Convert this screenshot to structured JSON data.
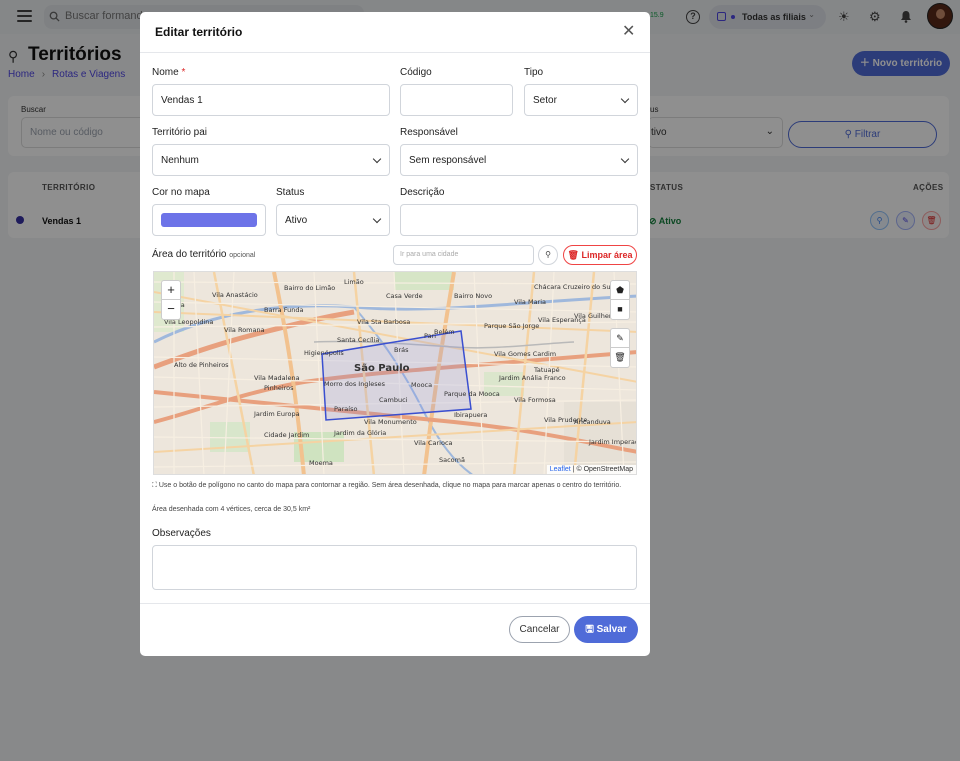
{
  "topbar": {
    "search_placeholder": "Buscar formando...",
    "version": "15.9",
    "help": "?",
    "branch_label": "Todas as filiais",
    "branch_chevron": "⌄"
  },
  "page": {
    "title": "Territórios",
    "breadcrumb": [
      "Home",
      "Rotas e Viagens"
    ],
    "new_button": "Novo território"
  },
  "filters": {
    "search_label": "Buscar",
    "search_placeholder": "Nome ou código",
    "status_label": "us",
    "status_value": "tivo",
    "filter_button": "Filtrar"
  },
  "table": {
    "columns": [
      "TERRITÓRIO",
      "STATUS",
      "AÇÕES"
    ],
    "rows": [
      {
        "name": "Vendas 1",
        "status": "Ativo"
      }
    ]
  },
  "modal": {
    "title": "Editar território",
    "fields": {
      "name": {
        "label": "Nome",
        "required": "*",
        "value": "Vendas 1"
      },
      "code": {
        "label": "Código",
        "value": ""
      },
      "type": {
        "label": "Tipo",
        "value": "Setor"
      },
      "parent": {
        "label": "Território pai",
        "value": "Nenhum"
      },
      "responsible": {
        "label": "Responsável",
        "value": "Sem responsável"
      },
      "color": {
        "label": "Cor no mapa",
        "value": "#6d73e8"
      },
      "status": {
        "label": "Status",
        "value": "Ativo"
      },
      "description": {
        "label": "Descrição",
        "value": ""
      }
    },
    "area": {
      "label": "Área do território",
      "optional": "opcional",
      "city_placeholder": "Ir para uma cidade",
      "clear_button": "Limpar área",
      "map": {
        "zoom_in": "+",
        "zoom_out": "−",
        "places": [
          "Vila Anastácio",
          "Bairro do Limão",
          "Limão",
          "Casa Verde",
          "Bairro Novo",
          "Chácara Cruzeiro do Sul",
          "Lapa",
          "Barra Funda",
          "Vila Maria",
          "Vila Leopoldina",
          "Vila Sta Barbosa",
          "Vila Esperança",
          "Vila Guilherme",
          "Vila Romana",
          "Santa Cecília",
          "Pari",
          "Parque São Jorge",
          "Higienópolis",
          "Belém",
          "Alto de Pinheiros",
          "Brás",
          "Vila Gomes Cardim",
          "São Paulo",
          "Vila Madalena",
          "Tatuapé",
          "Morro dos Ingleses",
          "Mooca",
          "Jardim Anália Franco",
          "Pinheiros",
          "Cambuci",
          "Parque da Mooca",
          "Vila Formosa",
          "Jardim Europa",
          "Paraíso",
          "Ibirapuera",
          "Vila Monumento",
          "Jardim da Glória",
          "Vila Prudente",
          "Cidade Jardim",
          "Vila Carioca",
          "Aricanduva",
          "Moema",
          "Sacomã",
          "Jardim Imperador"
        ],
        "attribution_leaflet": "Leaflet",
        "attribution_osm": "| © OpenStreetMap"
      },
      "hint": "Use o botão de polígono no canto do mapa para contornar a região. Sem área desenhada, clique no mapa para marcar apenas o centro do território.",
      "drawn_info": "Área desenhada com 4 vértices, cerca de 30,5 km²"
    },
    "observations": {
      "label": "Observações",
      "value": ""
    },
    "buttons": {
      "cancel": "Cancelar",
      "save": "Salvar"
    }
  },
  "colors": {
    "accent": "#4f6bd8",
    "active_green": "#15803d",
    "danger": "#dc2626",
    "polygon": "#3a4fd0"
  }
}
